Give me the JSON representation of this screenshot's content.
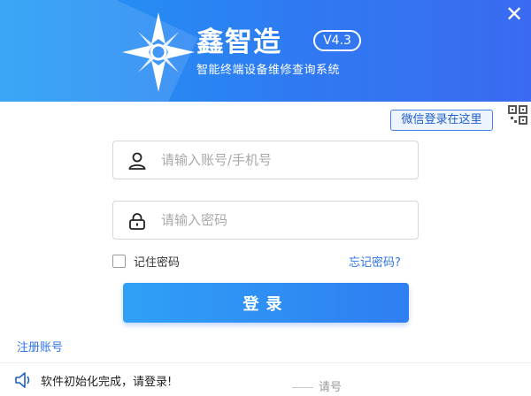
{
  "header": {
    "brand_name": "鑫智造",
    "version": "V4.3",
    "tagline": "智能终端设备维修查询系统",
    "close_glyph": "✕"
  },
  "wechat": {
    "tip": "微信登录在这里",
    "icon": "qr-code-icon"
  },
  "form": {
    "account_placeholder": "请输入账号/手机号",
    "account_value": "",
    "password_placeholder": "请输入密码",
    "password_value": "",
    "remember_label": "记住密码",
    "remember_checked": false,
    "forgot_label": "忘记密码?",
    "login_label": "登录"
  },
  "register_label": "注册账号",
  "status": {
    "message": "软件初始化完成，请登录!",
    "ghost_text": "请号"
  },
  "colors": {
    "header_start": "#1e9bf4",
    "header_end": "#3a6af0",
    "link": "#2f74e8",
    "button_start": "#2fa0f6",
    "button_end": "#2f7ef2"
  }
}
